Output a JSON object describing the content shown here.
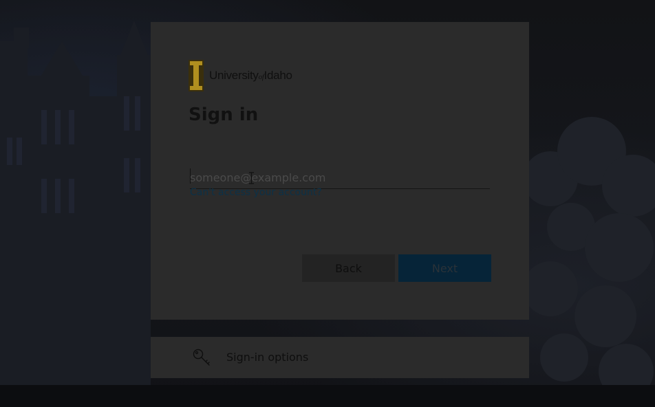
{
  "brand": {
    "name_prefix": "University",
    "name_of": "of",
    "name_suffix": "Idaho",
    "accent_color": "#b08f1f"
  },
  "signin": {
    "title": "Sign in",
    "email_placeholder": "someone@example.com",
    "email_value": "",
    "cant_access_link": "Can't access your account?",
    "back_label": "Back",
    "next_label": "Next"
  },
  "options": {
    "label": "Sign-in options",
    "icon": "key-icon"
  },
  "colors": {
    "card_bg": "#2b2b2b",
    "next_button": "#062438",
    "link": "#0c3147"
  }
}
